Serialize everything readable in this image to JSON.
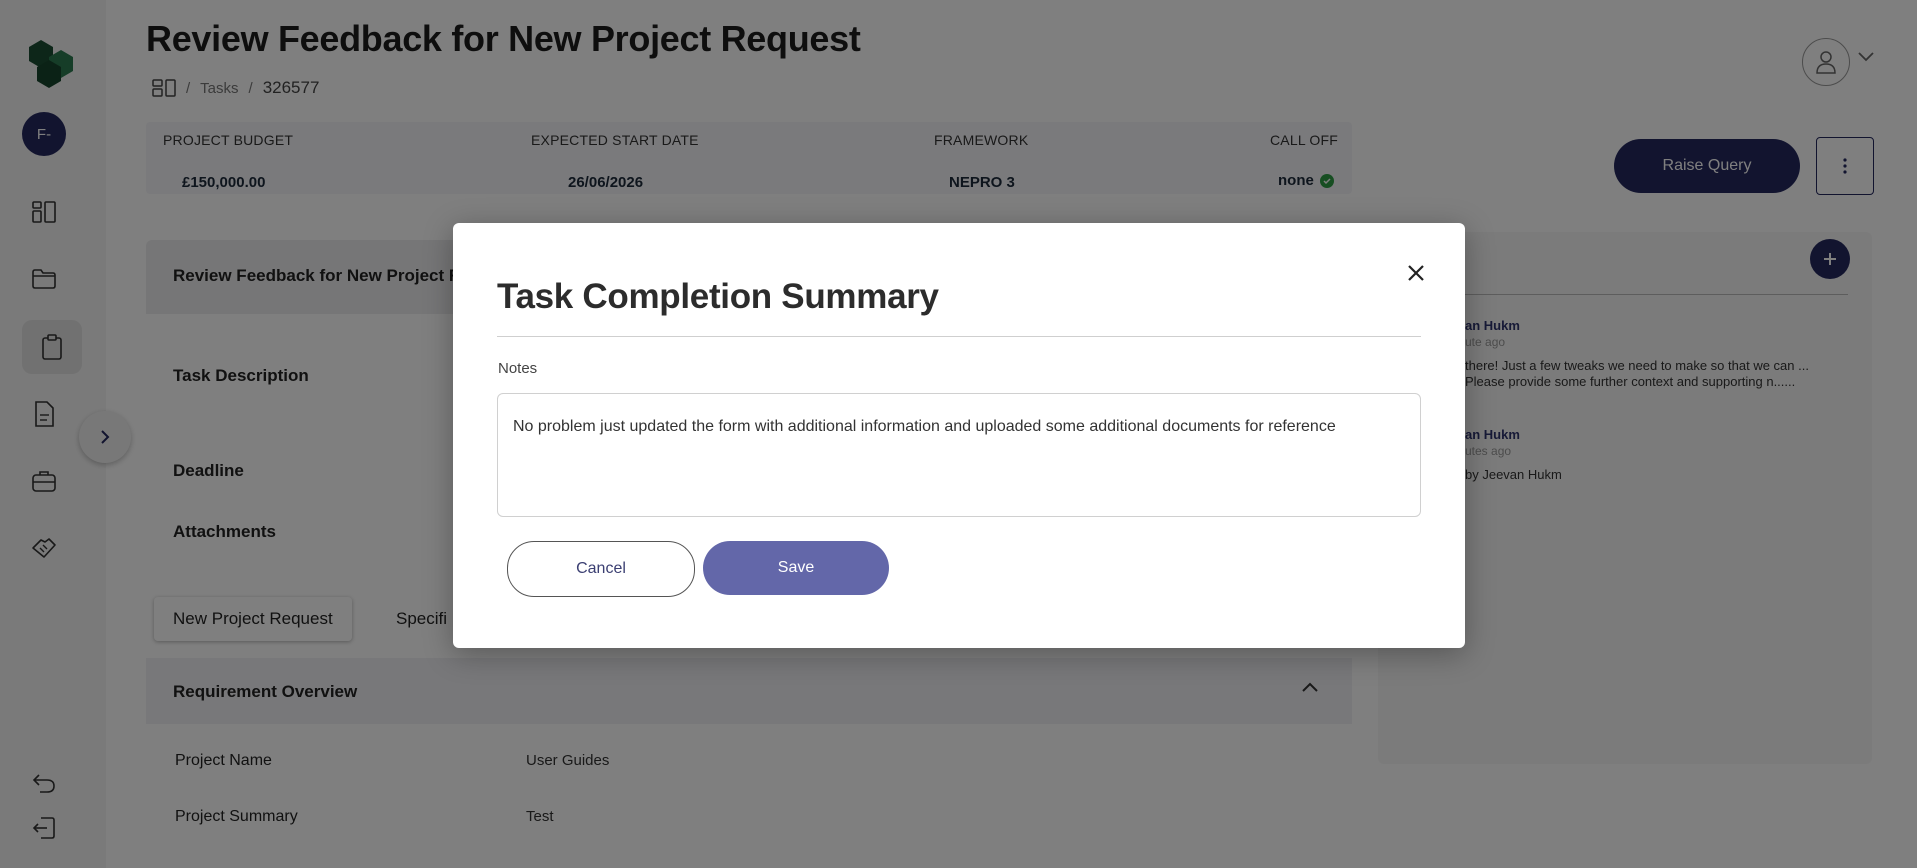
{
  "app": {
    "user_initials": "F-"
  },
  "header": {
    "title": "Review Feedback for New Project Request",
    "breadcrumb": {
      "separator": "/",
      "tasks_label": "Tasks",
      "current": "326577"
    }
  },
  "info_bar": {
    "budget_label": "PROJECT BUDGET",
    "budget_value": "£150,000.00",
    "start_label": "EXPECTED START DATE",
    "start_value": "26/06/2026",
    "framework_label": "FRAMEWORK",
    "framework_value": "NEPRO 3",
    "calloff_label": "CALL OFF",
    "calloff_value": "none"
  },
  "actions": {
    "raise_query": "Raise Query"
  },
  "task_panel": {
    "header_title": "Review Feedback for New Project Rec",
    "description_label": "Task Description",
    "deadline_label": "Deadline",
    "attachments_label": "Attachments"
  },
  "tabs": [
    {
      "label": "New Project Request"
    },
    {
      "label": "Specifi"
    }
  ],
  "requirement": {
    "title": "Requirement Overview",
    "rows": [
      {
        "label": "Project Name",
        "value": "User Guides"
      },
      {
        "label": "Project Summary",
        "value": "Test"
      }
    ]
  },
  "comments": [
    {
      "author": "an Hukm",
      "time": "ute ago",
      "text": "there! Just a few tweaks we need to make so that we can ... Please provide some further context and supporting n......"
    },
    {
      "author": "an Hukm",
      "time": "utes ago",
      "text": "by Jeevan Hukm"
    }
  ],
  "modal": {
    "title": "Task Completion Summary",
    "notes_label": "Notes",
    "notes_value": "No problem just updated the form with additional information and uploaded some additional documents for reference",
    "cancel_label": "Cancel",
    "save_label": "Save"
  },
  "colors": {
    "brand_navy": "#24285f",
    "save_button": "#6367a9",
    "check_green": "#2e9d44",
    "logo_green": "#1f5a3a"
  }
}
